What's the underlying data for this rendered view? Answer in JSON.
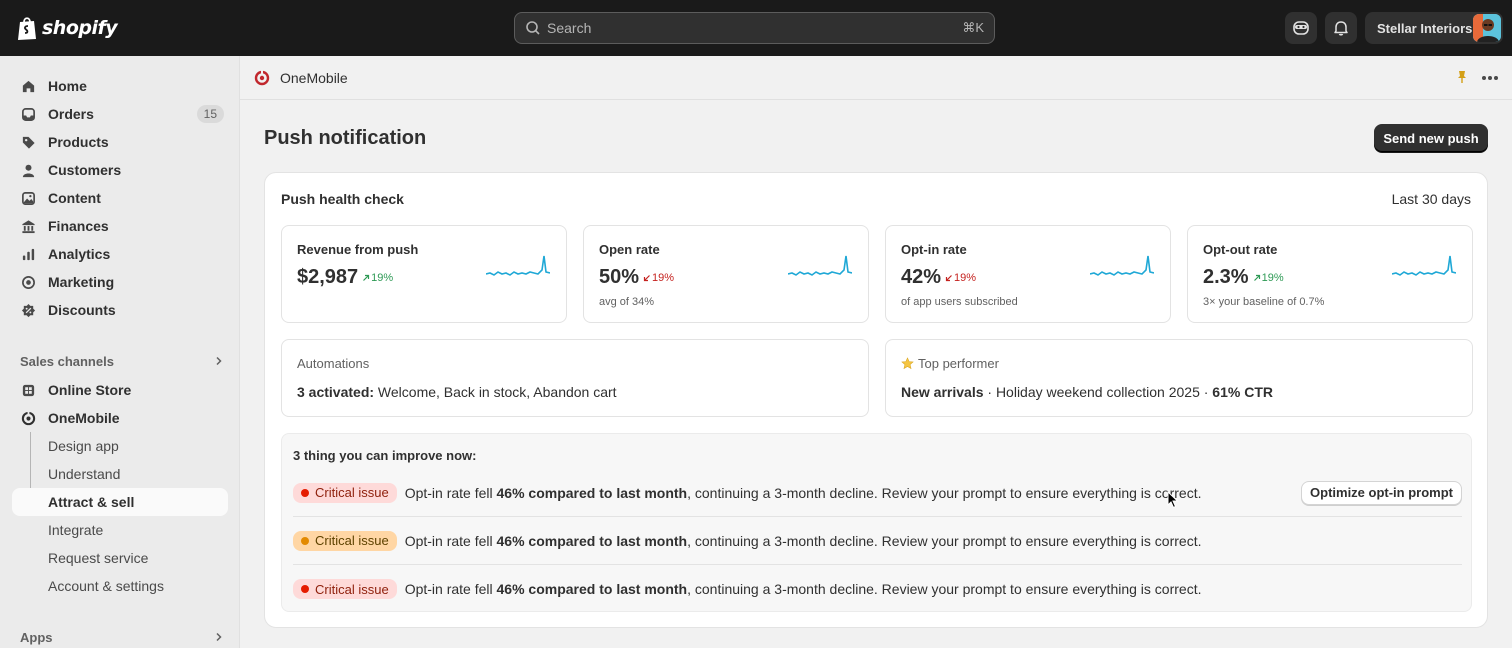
{
  "topbar": {
    "logo_text": "shopify",
    "search_placeholder": "Search",
    "search_shortcut": "⌘K",
    "store_name": "Stellar Interiors"
  },
  "sidebar": {
    "items": [
      {
        "label": "Home",
        "icon": "home-icon"
      },
      {
        "label": "Orders",
        "icon": "orders-icon",
        "badge": "15"
      },
      {
        "label": "Products",
        "icon": "tag-icon"
      },
      {
        "label": "Customers",
        "icon": "person-icon"
      },
      {
        "label": "Content",
        "icon": "image-icon"
      },
      {
        "label": "Finances",
        "icon": "bank-icon"
      },
      {
        "label": "Analytics",
        "icon": "bar-chart-icon"
      },
      {
        "label": "Marketing",
        "icon": "target-icon"
      },
      {
        "label": "Discounts",
        "icon": "discount-icon"
      }
    ],
    "sales_channels_label": "Sales channels",
    "channels": [
      {
        "label": "Online Store",
        "icon": "store-icon"
      },
      {
        "label": "OneMobile",
        "icon": "onemobile-icon"
      }
    ],
    "sub_items": [
      {
        "label": "Design app"
      },
      {
        "label": "Understand"
      },
      {
        "label": "Attract & sell"
      },
      {
        "label": "Integrate"
      },
      {
        "label": "Request service"
      },
      {
        "label": "Account & settings"
      }
    ],
    "apps_label": "Apps"
  },
  "app_header": {
    "name": "OneMobile"
  },
  "page": {
    "title": "Push notification",
    "primary_button": "Send new push"
  },
  "health": {
    "title": "Push health check",
    "range": "Last 30 days",
    "metrics": [
      {
        "label": "Revenue from push",
        "value": "$2,987",
        "delta": "19%",
        "direction": "up",
        "sub": ""
      },
      {
        "label": "Open rate",
        "value": "50%",
        "delta": "19%",
        "direction": "down",
        "sub": "avg of 34%"
      },
      {
        "label": "Opt-in rate",
        "value": "42%",
        "delta": "19%",
        "direction": "down",
        "sub": "of app users subscribed"
      },
      {
        "label": "Opt-out rate",
        "value": "2.3%",
        "delta": "19%",
        "direction": "up",
        "sub": "3× your baseline of 0.7%"
      }
    ],
    "automations": {
      "label": "Automations",
      "strong": "3 activated:",
      "text": " Welcome, Back in stock, Abandon cart"
    },
    "top_performer": {
      "label": "Top performer",
      "strong": "New arrivals",
      "middle": " · Holiday weekend collection 2025 · ",
      "ctr": "61% CTR"
    }
  },
  "improve": {
    "title": "3 thing you can improve now:",
    "issues": [
      {
        "badge": "Critical issue",
        "tone": "red",
        "pre": "Opt-in rate fell ",
        "strong": "46% compared to last month",
        "post": ", continuing a 3-month decline. Review your prompt to ensure everything is correct.",
        "action": "Optimize opt-in prompt"
      },
      {
        "badge": "Critical issue",
        "tone": "orange",
        "pre": "Opt-in rate fell ",
        "strong": "46% compared to last month",
        "post": ", continuing a 3-month decline. Review your prompt to ensure everything is correct."
      },
      {
        "badge": "Critical issue",
        "tone": "red",
        "pre": "Opt-in rate fell ",
        "strong": "46% compared to last month",
        "post": ", continuing a 3-month decline. Review your prompt to ensure everything is correct."
      }
    ]
  },
  "colors": {
    "sparkline": "#1fa8d6",
    "delta_up": "#2e9a55",
    "delta_down": "#c5221f",
    "brand_accent": "#c1272d"
  }
}
